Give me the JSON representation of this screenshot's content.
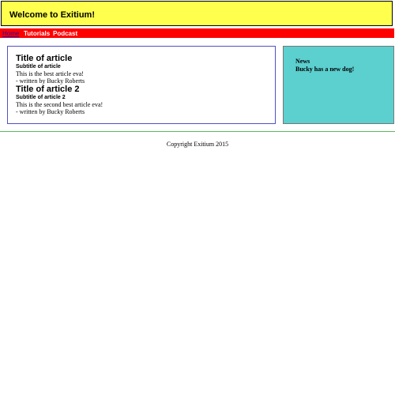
{
  "header": {
    "title": "Welcome to Exitium!"
  },
  "nav": {
    "items": [
      {
        "label": "Home"
      },
      {
        "label": "Tutorials"
      },
      {
        "label": "Podcast"
      }
    ]
  },
  "articles": [
    {
      "title": "Title of article",
      "subtitle": "Subtitle of article",
      "body": "This is the best article eva!",
      "byline": "- written by Bucky Roberts"
    },
    {
      "title": "Title of article 2",
      "subtitle": "Subtitle of article 2",
      "body": "This is the second best article eva!",
      "byline": "- written by Bucky Roberts"
    }
  ],
  "aside": {
    "heading": "News",
    "story": "Bucky has a new dog!"
  },
  "footer": {
    "text": "Copyright Exitium 2015"
  },
  "colors": {
    "header_bg": "#ffff4d",
    "nav_bg": "#ff0000",
    "aside_bg": "#5ccfcf",
    "divider": "#5cb85c",
    "main_border": "#5050c8"
  }
}
